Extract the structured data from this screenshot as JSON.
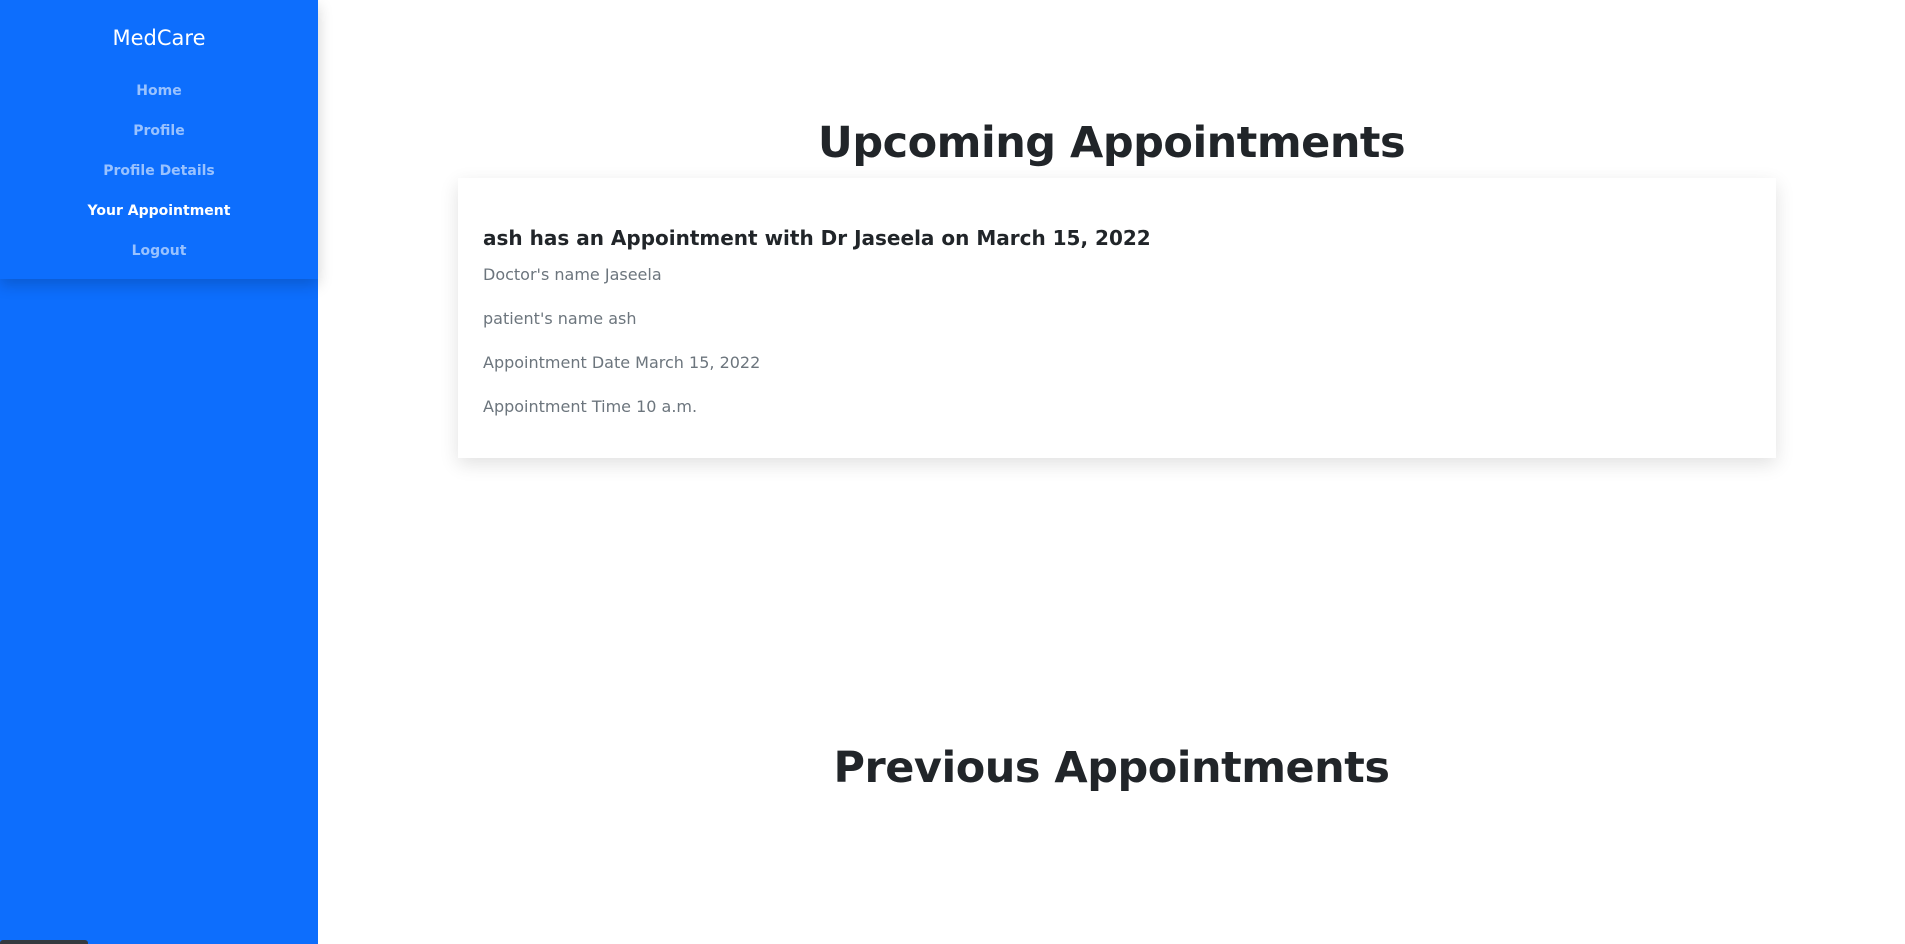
{
  "sidebar": {
    "brand": "MedCare",
    "items": [
      {
        "label": "Home"
      },
      {
        "label": "Profile"
      },
      {
        "label": "Profile Details"
      },
      {
        "label": "Your Appointment"
      },
      {
        "label": "Logout"
      }
    ],
    "active_index": 3
  },
  "main": {
    "upcoming_title": "Upcoming Appointments",
    "previous_title": "Previous Appointments",
    "appointment": {
      "heading": "ash has an Appointment with Dr Jaseela on March 15, 2022",
      "doctor_label": "Doctor's name",
      "doctor_value": "Jaseela",
      "patient_label": "patient's name",
      "patient_value": "ash",
      "date_label": "Appointment Date",
      "date_value": "March 15, 2022",
      "time_label": "Appointment Time",
      "time_value": "10 a.m."
    }
  },
  "colors": {
    "sidebar_bg": "#0d6efd",
    "heading": "#212529",
    "muted_text": "#6c757d"
  }
}
